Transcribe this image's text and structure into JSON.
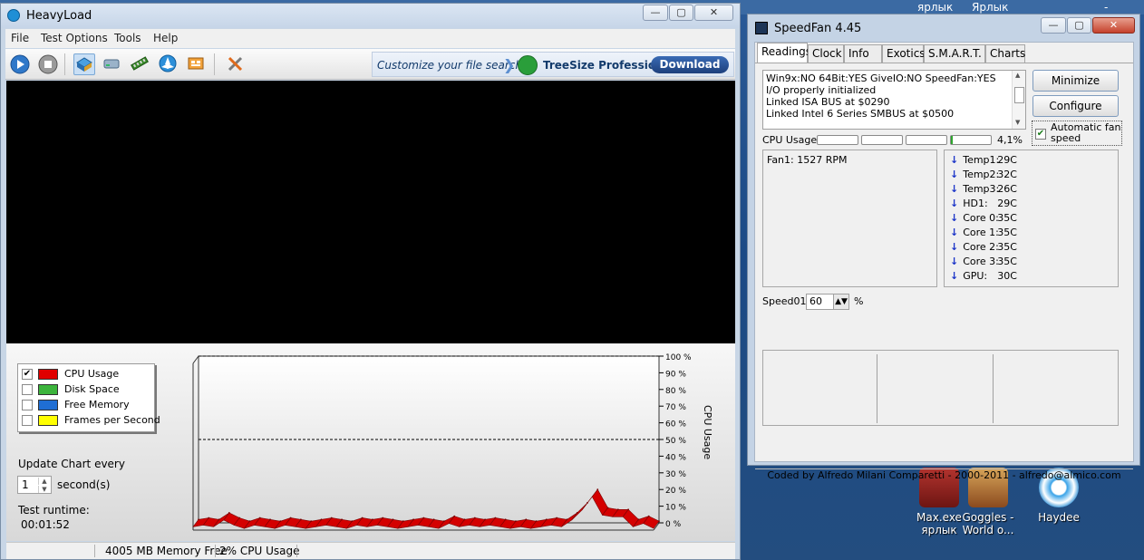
{
  "desktop": {
    "top_labels": [
      "ярлык",
      "Ярлык",
      "- Ярлык"
    ],
    "icons": [
      {
        "label_line1": "Max.exe",
        "label_line2": "ярлык"
      },
      {
        "label_line1": "Goggles -",
        "label_line2": "World o..."
      },
      {
        "label_line1": "Haydee",
        "label_line2": ""
      }
    ]
  },
  "heavyload": {
    "title": "HeavyLoad",
    "window_buttons": {
      "minimize": "—",
      "maximize": "▢",
      "close": "✕"
    },
    "menu": [
      "File",
      "Test Options",
      "Tools",
      "Help"
    ],
    "toolbar_icons": [
      "play-icon",
      "stop-icon",
      "cpu-icon",
      "disk-icon",
      "memory-icon",
      "gpu-icon",
      "treesize-icon",
      "tools-icon"
    ],
    "ad": {
      "text": "Customize your file search",
      "product": "TreeSize Professional",
      "button": "Download"
    },
    "legend": [
      {
        "label": "CPU Usage",
        "color": "#e00000",
        "checked": true
      },
      {
        "label": "Disk Space",
        "color": "#3cb43c",
        "checked": false
      },
      {
        "label": "Free Memory",
        "color": "#1f6ed4",
        "checked": false
      },
      {
        "label": "Frames per Second",
        "color": "#ffff00",
        "checked": false
      }
    ],
    "update_label": "Update Chart every",
    "update_value": "1",
    "update_unit": "second(s)",
    "runtime_label": "Test runtime:",
    "runtime_value": "00:01:52",
    "status": {
      "memory": "4005 MB Memory Free",
      "cpu": "2% CPU Usage"
    }
  },
  "chart_data": {
    "type": "area",
    "ylabel": "CPU Usage",
    "ylim": [
      0,
      100
    ],
    "yticks": [
      "100 %",
      "90 %",
      "80 %",
      "70 %",
      "60 %",
      "50 %",
      "40 %",
      "30 %",
      "20 %",
      "10 %",
      "0 %"
    ],
    "reference_line": 50,
    "series": [
      {
        "values": [
          2,
          3,
          2,
          6,
          3,
          1,
          3,
          2,
          1,
          3,
          2,
          1,
          2,
          3,
          2,
          1,
          3,
          2,
          3,
          2,
          1,
          2,
          3,
          2,
          1,
          4,
          2,
          3,
          2,
          3,
          2,
          1,
          2,
          1,
          2,
          3,
          2,
          6,
          12,
          20,
          9,
          8,
          8,
          2,
          4,
          1
        ]
      }
    ]
  },
  "speedfan": {
    "title": "SpeedFan 4.45",
    "window_buttons": {
      "minimize": "—",
      "maximize": "▢",
      "close": "✕"
    },
    "tabs": [
      "Readings",
      "Clock",
      "Info",
      "Exotics",
      "S.M.A.R.T.",
      "Charts"
    ],
    "log": [
      "Win9x:NO  64Bit:YES  GiveIO:NO  SpeedFan:YES",
      "I/O properly initialized",
      "Linked ISA BUS at $0290",
      "Linked Intel 6 Series SMBUS at $0500"
    ],
    "buttons": {
      "minimize": "Minimize",
      "configure": "Configure"
    },
    "auto_fan_label": "Automatic fan speed",
    "auto_fan_checked": true,
    "cpu_label": "CPU Usage",
    "cpu_meters": [
      0,
      0,
      0,
      0.04
    ],
    "cpu_value": "4,1%",
    "fans": [
      "Fan1: 1527 RPM"
    ],
    "temps": [
      {
        "name": "Temp1:",
        "value": "29C"
      },
      {
        "name": "Temp2:",
        "value": "32C"
      },
      {
        "name": "Temp3:",
        "value": "26C"
      },
      {
        "name": "HD1:",
        "value": "29C"
      },
      {
        "name": "Core 0:",
        "value": "35C"
      },
      {
        "name": "Core 1:",
        "value": "35C"
      },
      {
        "name": "Core 2:",
        "value": "35C"
      },
      {
        "name": "Core 3:",
        "value": "35C"
      },
      {
        "name": "GPU:",
        "value": "30C"
      }
    ],
    "speed_label": "Speed01:",
    "speed_value": "60",
    "speed_unit": "%",
    "footer": "Coded by Alfredo Milani Comparetti - 2000-2011 - alfredo@almico.com"
  }
}
